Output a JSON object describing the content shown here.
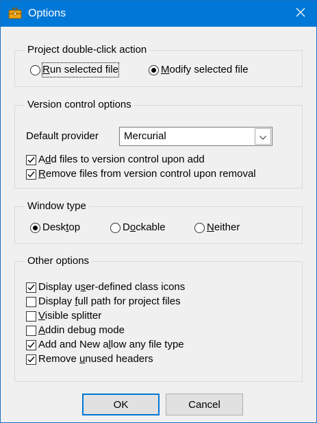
{
  "window": {
    "title": "Options",
    "title_icon": "briefcase-icon",
    "close_icon": "close-icon",
    "accent": "#0078d7"
  },
  "project_group": {
    "legend": "Project double-click action",
    "options": [
      {
        "pre": "",
        "key": "R",
        "post": "un selected file",
        "selected": false
      },
      {
        "pre": "",
        "key": "M",
        "post": "odify selected file",
        "selected": true
      }
    ]
  },
  "vc_group": {
    "legend": "Version control options",
    "provider_label": "Default provider",
    "provider_value": "Mercurial",
    "checks": [
      {
        "pre": "A",
        "key": "d",
        "post": "d files to version control upon add",
        "checked": true
      },
      {
        "pre": "",
        "key": "R",
        "post": "emove files from version control upon removal",
        "checked": true
      }
    ]
  },
  "window_group": {
    "legend": "Window type",
    "options": [
      {
        "pre": "Desk",
        "key": "t",
        "post": "op",
        "selected": true
      },
      {
        "pre": "D",
        "key": "o",
        "post": "ckable",
        "selected": false
      },
      {
        "pre": "",
        "key": "N",
        "post": "either",
        "selected": false
      }
    ]
  },
  "other_group": {
    "legend": "Other options",
    "checks": [
      {
        "pre": "Display u",
        "key": "s",
        "post": "er-defined class icons",
        "checked": true
      },
      {
        "pre": "Display ",
        "key": "f",
        "post": "ull path for project files",
        "checked": false
      },
      {
        "pre": "",
        "key": "V",
        "post": "isible splitter",
        "checked": false
      },
      {
        "pre": "",
        "key": "A",
        "post": "ddin debug mode",
        "checked": false
      },
      {
        "pre": "Add and New a",
        "key": "l",
        "post": "low any file type",
        "checked": true
      },
      {
        "pre": "Remove ",
        "key": "u",
        "post": "nused headers",
        "checked": true
      }
    ]
  },
  "buttons": {
    "ok": "OK",
    "cancel": "Cancel"
  }
}
